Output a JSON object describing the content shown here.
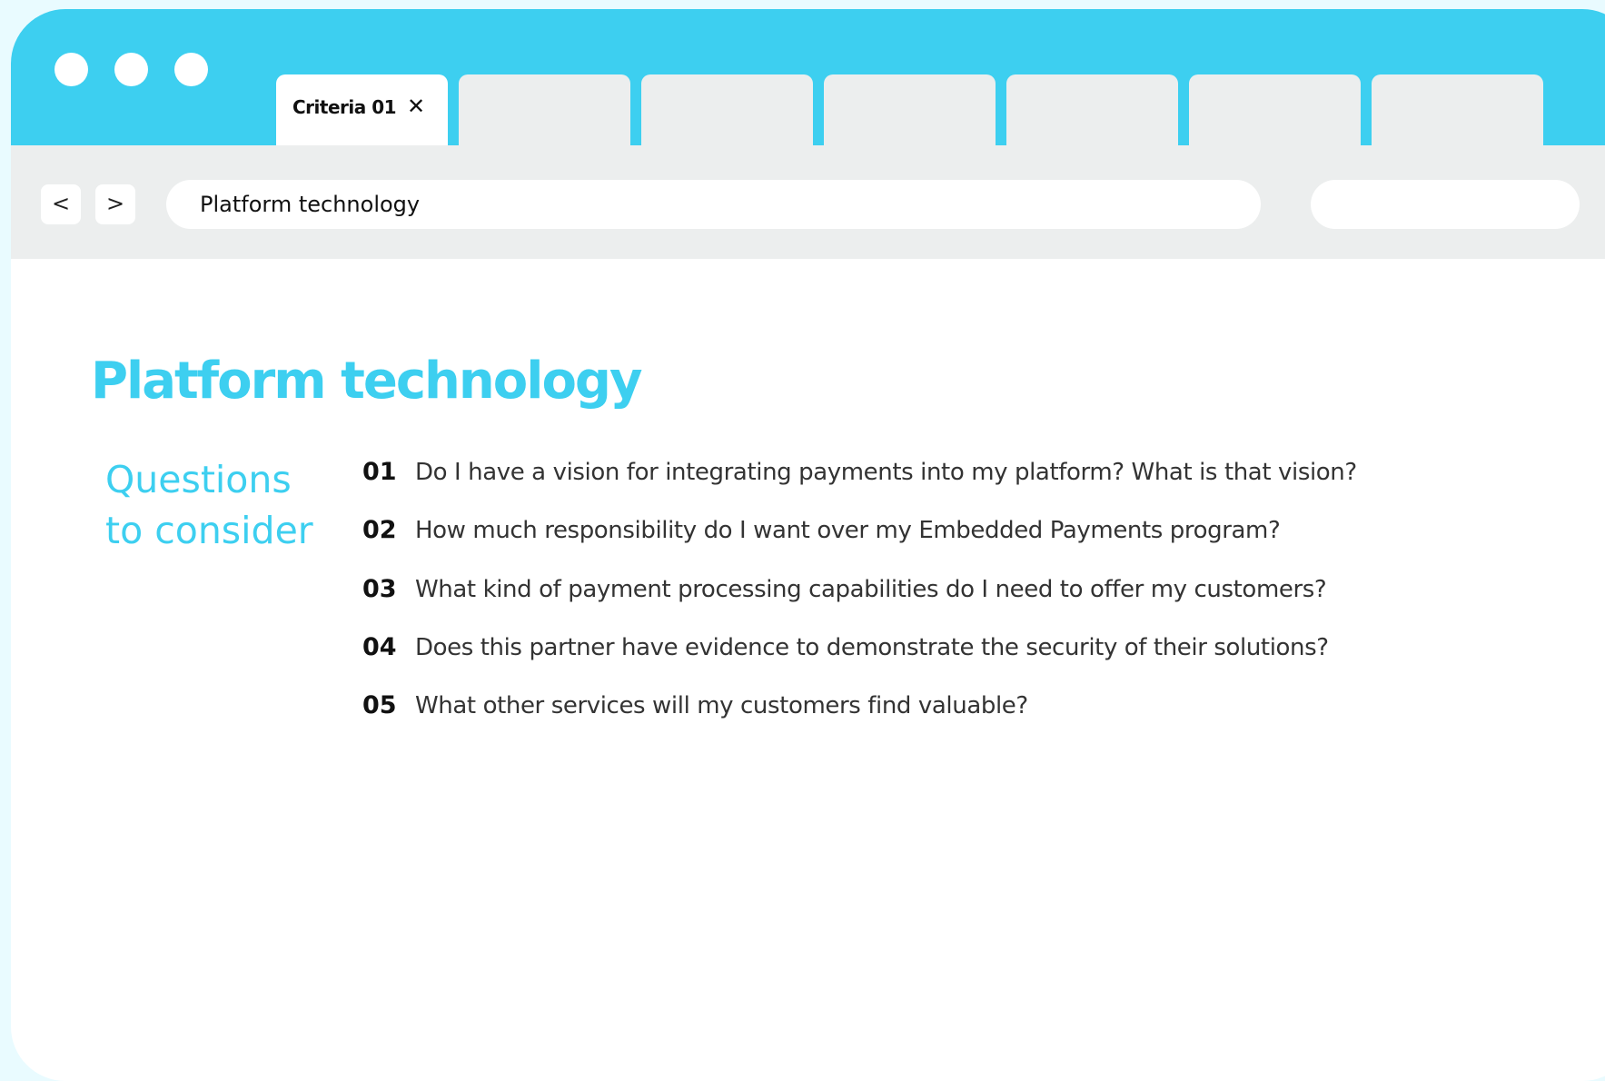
{
  "colors": {
    "accent": "#3dcff0",
    "tab_inactive": "#eceeee",
    "page_background": "#e9fbff"
  },
  "tabs": [
    {
      "label": "Criteria 01",
      "active": true,
      "close_icon": "close-icon"
    },
    {
      "label": "",
      "active": false
    },
    {
      "label": "",
      "active": false
    },
    {
      "label": "",
      "active": false
    },
    {
      "label": "",
      "active": false
    },
    {
      "label": "",
      "active": false
    },
    {
      "label": "",
      "active": false
    }
  ],
  "toolbar": {
    "back_label": "<",
    "forward_label": ">",
    "address_value": "Platform technology",
    "search_value": ""
  },
  "page": {
    "title": "Platform technology",
    "side_heading_line1": "Questions",
    "side_heading_line2": "to consider",
    "questions": [
      {
        "number": "01",
        "text": "Do I have a vision for integrating payments into my platform? What is that vision?"
      },
      {
        "number": "02",
        "text": "How much responsibility do I want over my Embedded Payments program?"
      },
      {
        "number": "03",
        "text": "What kind of payment processing capabilities do I need to offer my customers?"
      },
      {
        "number": "04",
        "text": "Does this partner have evidence to demonstrate the security of their solutions?"
      },
      {
        "number": "05",
        "text": "What other services will my customers find valuable?"
      }
    ]
  }
}
